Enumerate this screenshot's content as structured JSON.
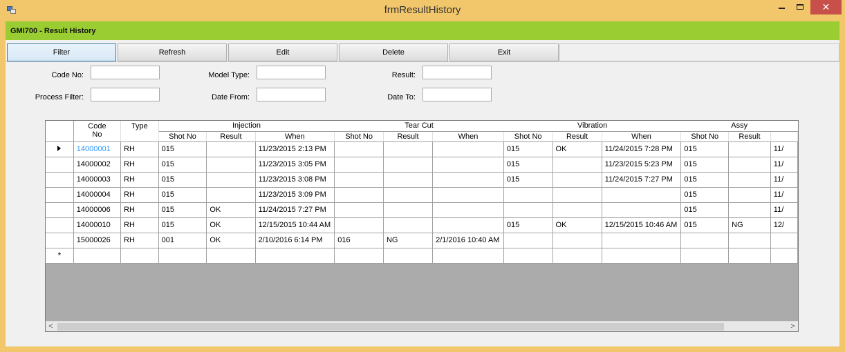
{
  "window": {
    "title": "frmResultHistory",
    "close_glyph": "✕"
  },
  "header": {
    "title": "GMI700 - Result History"
  },
  "toolbar": {
    "buttons": [
      "Filter",
      "Refresh",
      "Edit",
      "Delete",
      "Exit"
    ]
  },
  "filters": {
    "code_no": {
      "label": "Code No:",
      "value": ""
    },
    "model_type": {
      "label": "Model Type:",
      "value": ""
    },
    "result": {
      "label": "Result:",
      "value": ""
    },
    "process_filter": {
      "label": "Process Filter:",
      "value": ""
    },
    "date_from": {
      "label": "Date From:",
      "value": ""
    },
    "date_to": {
      "label": "Date To:",
      "value": ""
    }
  },
  "grid": {
    "col_code": "Code No",
    "col_type": "Type",
    "groups": [
      "Injection",
      "Tear Cut",
      "Vibration",
      "Assy"
    ],
    "sub_shot": "Shot No",
    "sub_result": "Result",
    "sub_when": "When",
    "rows": [
      [
        "14000001",
        "RH",
        "015",
        "",
        "11/23/2015 2:13 PM",
        "",
        "",
        "",
        "015",
        "OK",
        "11/24/2015 7:28 PM",
        "015",
        "",
        "11/"
      ],
      [
        "14000002",
        "RH",
        "015",
        "",
        "11/23/2015 3:05 PM",
        "",
        "",
        "",
        "015",
        "",
        "11/23/2015 5:23 PM",
        "015",
        "",
        "11/"
      ],
      [
        "14000003",
        "RH",
        "015",
        "",
        "11/23/2015 3:08 PM",
        "",
        "",
        "",
        "015",
        "",
        "11/24/2015 7:27 PM",
        "015",
        "",
        "11/"
      ],
      [
        "14000004",
        "RH",
        "015",
        "",
        "11/23/2015 3:09 PM",
        "",
        "",
        "",
        "",
        "",
        "",
        "015",
        "",
        "11/"
      ],
      [
        "14000006",
        "RH",
        "015",
        "OK",
        "11/24/2015 7:27 PM",
        "",
        "",
        "",
        "",
        "",
        "",
        "015",
        "",
        "11/"
      ],
      [
        "14000010",
        "RH",
        "015",
        "OK",
        "12/15/2015 10:44 AM",
        "",
        "",
        "",
        "015",
        "OK",
        "12/15/2015 10:46 AM",
        "015",
        "NG",
        "12/"
      ],
      [
        "15000026",
        "RH",
        "001",
        "OK",
        "2/10/2016 6:14 PM",
        "016",
        "NG",
        "2/1/2016 10:40 AM",
        "",
        "",
        "",
        "",
        "",
        ""
      ]
    ],
    "new_row_marker": "*",
    "scroll_left": "<",
    "scroll_right": ">"
  }
}
